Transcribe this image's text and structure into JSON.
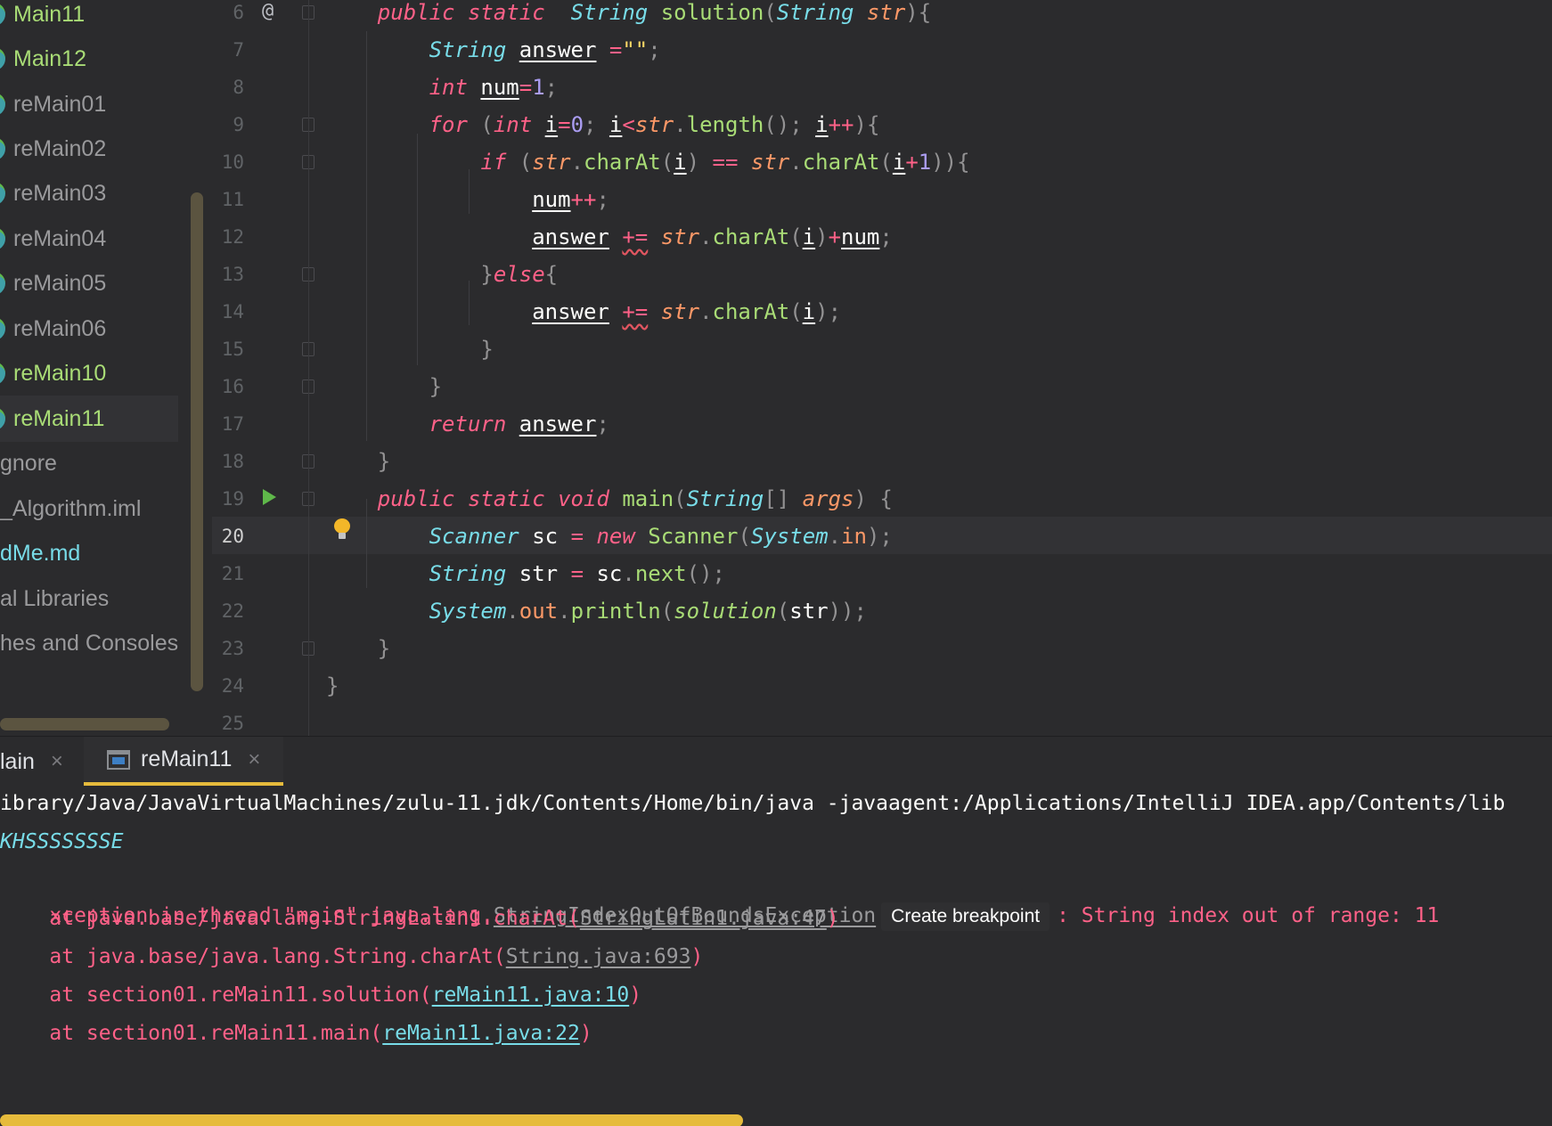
{
  "project_tree": {
    "items": [
      {
        "label": "Main11",
        "color": "#a9dc76",
        "icon": "java-class-icon"
      },
      {
        "label": "Main12",
        "color": "#a9dc76",
        "icon": "java-class-icon"
      },
      {
        "label": "reMain01",
        "color": "#9a9a9c",
        "icon": "java-class-icon"
      },
      {
        "label": "reMain02",
        "color": "#9a9a9c",
        "icon": "java-class-icon"
      },
      {
        "label": "reMain03",
        "color": "#9a9a9c",
        "icon": "java-class-icon"
      },
      {
        "label": "reMain04",
        "color": "#9a9a9c",
        "icon": "java-class-icon"
      },
      {
        "label": "reMain05",
        "color": "#9a9a9c",
        "icon": "java-class-icon"
      },
      {
        "label": "reMain06",
        "color": "#9a9a9c",
        "icon": "java-class-icon"
      },
      {
        "label": "reMain10",
        "color": "#a9dc76",
        "icon": "java-class-icon"
      },
      {
        "label": "reMain11",
        "color": "#a9dc76",
        "icon": "java-class-icon",
        "selected": true
      },
      {
        "label": "gnore",
        "color": "#9a9a9c"
      },
      {
        "label": "_Algorithm.iml",
        "color": "#9a9a9c"
      },
      {
        "label": "dMe.md",
        "color": "#78dce8"
      },
      {
        "label": "al Libraries",
        "color": "#9a9a9c"
      },
      {
        "label": "hes and Consoles",
        "color": "#9a9a9c"
      }
    ]
  },
  "editor": {
    "active_line": "20",
    "line_numbers": [
      "6",
      "7",
      "8",
      "9",
      "10",
      "11",
      "12",
      "13",
      "14",
      "15",
      "16",
      "17",
      "18",
      "19",
      "20",
      "21",
      "22",
      "23",
      "24",
      "25"
    ],
    "gutter": {
      "override_marker": "@",
      "run_icon": "run-icon",
      "intention_icon": "lightbulb-icon"
    },
    "tokens": {
      "public": "public",
      "static": "static",
      "void": "void",
      "int": "int",
      "for": "for",
      "if": "if",
      "else": "else",
      "return": "return",
      "new": "new",
      "String": "String",
      "Scanner": "Scanner",
      "System": "System",
      "solution": "solution",
      "main": "main",
      "length": "length",
      "charAt": "charAt",
      "next": "next",
      "println": "println",
      "str": "str",
      "args": "args",
      "answer": "answer",
      "num": "num",
      "i": "i",
      "sc": "sc",
      "in": "in",
      "out": "out",
      "zero": "0",
      "one": "1",
      "empty_string": "\"\""
    }
  },
  "run_panel": {
    "tabs": [
      {
        "label": "lain",
        "close": "×"
      },
      {
        "label": "reMain11",
        "close": "×",
        "active": true
      }
    ],
    "console": {
      "command": "ibrary/Java/JavaVirtualMachines/zulu-11.jdk/Contents/Home/bin/java -javaagent:/Applications/IntelliJ IDEA.app/Contents/lib",
      "input": "KHSSSSSSSE",
      "exception_prefix": "xception in thread \"main\" java.lang.",
      "exception_class": "StringIndexOutOfBoundsException",
      "breakpoint_chip": "Create breakpoint",
      "exception_message": ": String index out of range: 11",
      "stack": [
        {
          "prefix": "    at java.base/java.lang.StringLatin1.charAt(",
          "link": "StringLatin1.java:47",
          "suffix": ")",
          "project": false
        },
        {
          "prefix": "    at java.base/java.lang.String.charAt(",
          "link": "String.java:693",
          "suffix": ")",
          "project": false
        },
        {
          "prefix": "    at section01.reMain11.solution(",
          "link": "reMain11.java:10",
          "suffix": ")",
          "project": true
        },
        {
          "prefix": "    at section01.reMain11.main(",
          "link": "reMain11.java:22",
          "suffix": ")",
          "project": true
        }
      ]
    }
  }
}
